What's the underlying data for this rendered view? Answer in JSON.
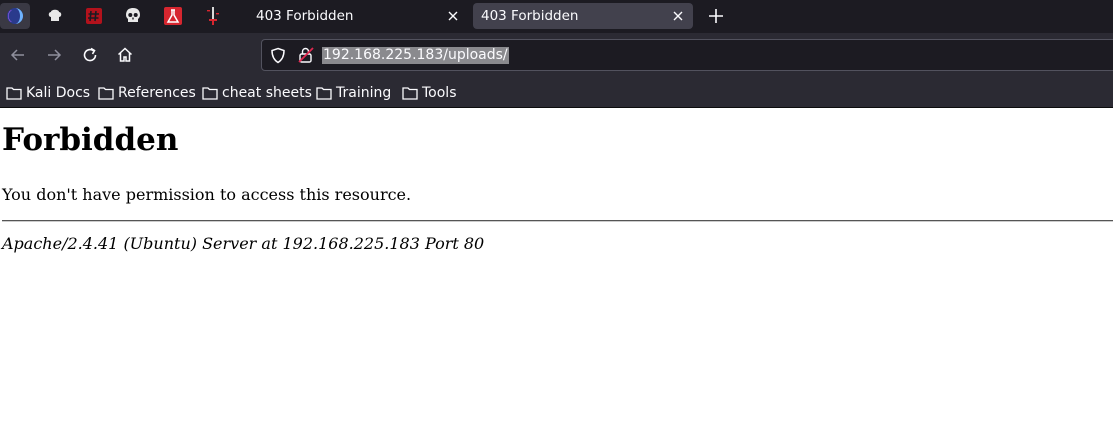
{
  "browser": {
    "pinned_tabs": [
      {
        "icon": "firefox-nightly-icon"
      },
      {
        "icon": "chef-hat-icon"
      },
      {
        "icon": "exploit-db-icon"
      },
      {
        "icon": "skull-icon"
      },
      {
        "icon": "flask-icon"
      },
      {
        "icon": "dagger-icon"
      }
    ],
    "tabs": [
      {
        "title": "403 Forbidden",
        "selected": false
      },
      {
        "title": "403 Forbidden",
        "selected": true
      }
    ],
    "url": "192.168.225.183/uploads/",
    "bookmarks": [
      {
        "label": "Kali Docs"
      },
      {
        "label": "References"
      },
      {
        "label": "cheat sheets"
      },
      {
        "label": "Training"
      },
      {
        "label": "Tools"
      }
    ],
    "colors": {
      "tabstrip_bg": "#1c1b22",
      "toolbar_bg": "#2b2a33",
      "selected_tab_bg": "#42414d",
      "text": "#fbfbfe"
    }
  },
  "page": {
    "heading": "Forbidden",
    "message": "You don't have permission to access this resource.",
    "server_signature": "Apache/2.4.41 (Ubuntu) Server at 192.168.225.183 Port 80"
  }
}
